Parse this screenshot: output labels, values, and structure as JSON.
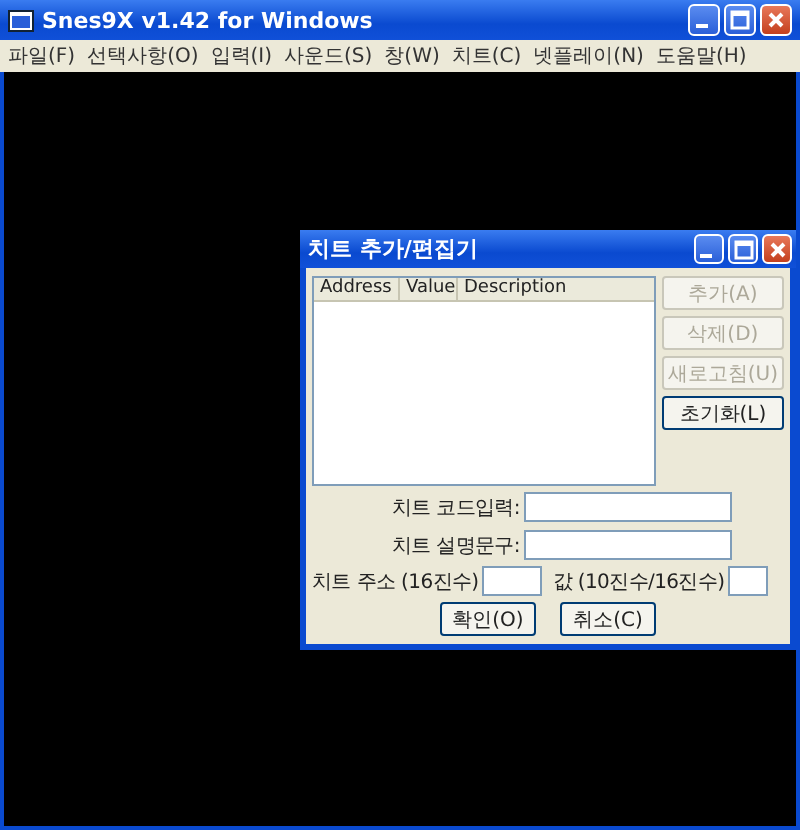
{
  "app": {
    "title": "Snes9X v1.42 for Windows",
    "menu": [
      "파일(F)",
      "선택사항(O)",
      "입력(I)",
      "사운드(S)",
      "창(W)",
      "치트(C)",
      "넷플레이(N)",
      "도움말(H)"
    ]
  },
  "dialog": {
    "title": "치트 추가/편집기",
    "columns": [
      "Address",
      "Value",
      "Description"
    ],
    "side_buttons": [
      {
        "label": "추가(A)",
        "disabled": true
      },
      {
        "label": "삭제(D)",
        "disabled": true
      },
      {
        "label": "새로고침(U)",
        "disabled": true
      },
      {
        "label": "초기화(L)",
        "disabled": false
      }
    ],
    "fields": [
      "치트 코드입력:",
      "치트 설명문구:"
    ],
    "address_label": "치트 주소 (16진수)",
    "value_label": "값 (10진수/16진수)",
    "buttons": [
      "확인(O)",
      "취소(C)"
    ]
  }
}
